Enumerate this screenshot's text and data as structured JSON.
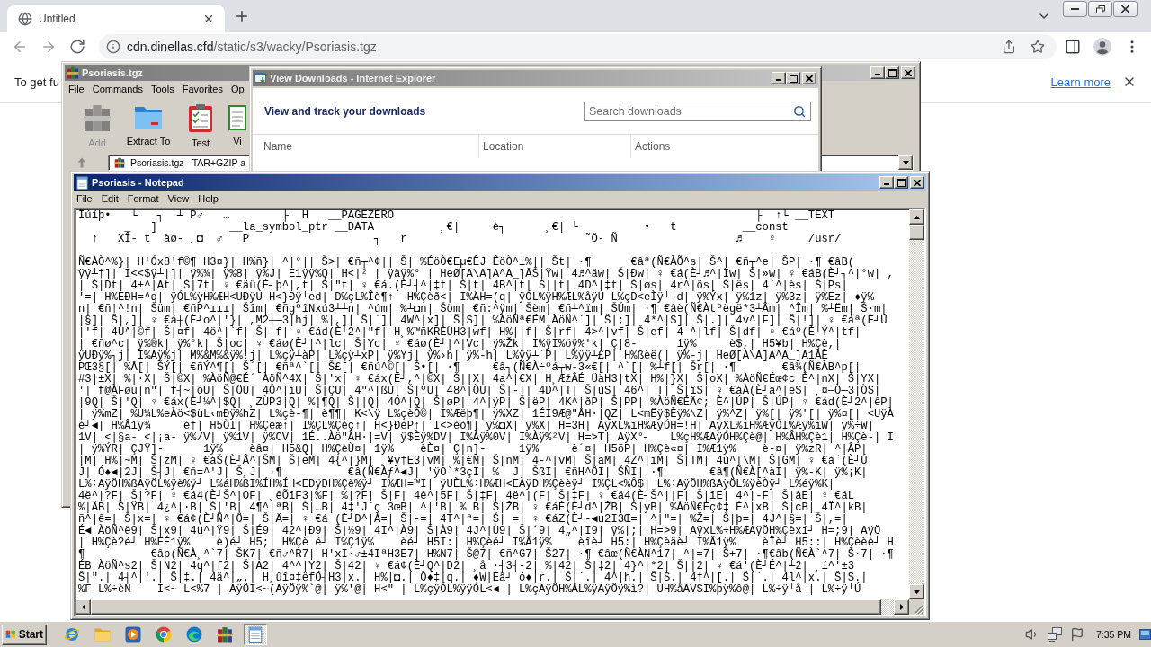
{
  "browser": {
    "tab": {
      "title": "Untitled"
    },
    "url": {
      "host": "cdn.dinellas.cfd",
      "path": "/static/s3/wacky/Psoriasis.tgz"
    },
    "infobar": {
      "text": "To get fu",
      "link": "Learn more"
    }
  },
  "winrar": {
    "title": "Psoriasis.tgz",
    "active": false,
    "menu": [
      "File",
      "Commands",
      "Tools",
      "Favorites",
      "Op"
    ],
    "toolbar": [
      {
        "kind": "add",
        "label": "Add",
        "disabled": true
      },
      {
        "kind": "extract",
        "label": "Extract To",
        "disabled": false
      },
      {
        "kind": "test",
        "label": "Test",
        "disabled": false
      },
      {
        "kind": "view",
        "label": "Vi",
        "disabled": false
      }
    ],
    "path": "Psoriasis.tgz - TAR+GZIP a"
  },
  "downloads": {
    "title": "View Downloads - Internet Explorer",
    "active": false,
    "heading": "View and track your downloads",
    "search": {
      "placeholder": "Search downloads"
    },
    "columns": [
      "Name",
      "Location",
      "Actions"
    ]
  },
  "notepad": {
    "title": "Psoriasis - Notepad",
    "active": true,
    "menu": [
      "File",
      "Edit",
      "Format",
      "View",
      "Help"
    ],
    "header_lines": [
      "Ïúíþ•   └   ┐  ┴ P♂   …        ├  H   __PAGEZERO                                                       ├  ↑└ __TEXT",
      "       _   ]           __la_symbol_ptr __DATA          ¸€|     è┐      ¸€| └          •   t          __const",
      "  ↑   XÎ- t  àø- ¸◘  ♂   P                   ┐   r                           ˜Ö- Ñ                  ♬    ♀     /usr/"
    ],
    "body_lines": [
      "Ñ€ÀÒ^%}| H'Óx8'f©¶ H3¤}| H%ñ}| ^|°|| Š>| €ñ┬^¢|| Š| %ÉöÒ€Eµ€ÊJ ÊöÒ^±%|| Št| ·¶      €âª(Ñ€ÀÕ^s| Š^| €ñ┬^e| ŠP| ·¶ €âB(",
      "ÿý┴†]| I<<$ÿ┴|]| ÿ%¾| ÿ%8| ÿ%J| E1ÿÿ%Q| H<|² | ÿàÿ%° | HeØ[A\\A]A^A_]ÅŠ|Ÿw| 4♬^äw| Š|Ðw| ♀ €á(È┘♬^|Ïw| Š|»w| ♀ €áB(È┘┐^|°w| ,",
      "| Š|Dt| 4±^|At| Š|7t| ♀ €äü(È┘þ^|,t| Š|\"t| ♀ €á.(È┘┤^|‡t| Š|t| 4B^|t| Š||t| 4D^|‡t| Š|øs| 4r^|ös| Š|ës| 4`^|ès| Š|Ps|",
      "'=| H%EÐH=^q| ÿÓL%ÿH%ÆH<UÐÿU H<}Ðÿ┴ed| D%çL%Îè¶↑  H%Çèð<| I%ÄH=(q| ÿÓL%ÿH%ÆL%åÿU L%çD<eÌÿ┴-d| ÿ%Ýx| ÿ%1z| ÿ%3z| ÿ%Ez| ♦ÿ%",
      "n| €ñ†^!n| Šüm| €ñP^ııı| Šîm| €ñgºîNxú3┴┴n| ^úm| %┴◘n| Šöm| €ñ:^ÿm| Šèm| €ñ┴^ïm| ŠÚm| ·¶ €âè(Ñ€Àtºëgë*3┴Âm| ^Îm| %┴Ëm| Š·m|",
      "|§]| Š|,]| ♀ €á┼(È┘o^|'}| ,M2┼─3|hj| %|,]| Š|`]| 4W^|x]| Š|S]| %ÀöÑª€ÉM ÀöÑ^`]| Š|;]| 4*^|S]| Š|.]| 4v^|F]| Š|!]| ♀ €áª(È┘Ú",
      "|'f| 4Ù^|©f| Š|¤f| 4ö^|`f| Š|—f| ♀ €ád(È┘2^|\"f| H¸%™ñKRÈÜH3|wf| H%||f| Š|rf| 4>^|vf| Š|ef| 4 ^|lf| Š|df| ♀ €áº(È┘Ý^|tf|",
      "| €ñø^c| ÿ%®k| ÿ%°k| Š|oc| ♀ €áø(È┘|^|lc| Š|Yc| ♀ €áø(È┘|^|Vc| ÿ%Žk| I%ÿI%öÿ%'k| Ç|8-      1ÿ%     è$,| H5¥b| H%Çè,|",
      "ÿUÐÿ%┐j| I%Äÿ%j| M%&M%&ÿ%!j| L%çÿ┴àP| L%çÿ┴xP| ÿ%Yj| ÿ%›h| ÿ%-h| L%ÿÿ┴´P| L%ÿÿ┴£P| H%ßèë(| ÿ%-j| HeØ[A\\A]A^A_]Å1ÀÈ",
      "PŒ3§[| %Å[| ŠÝ[| €ñÝ^¶[| Š´[| €ñª^`[| Š£[| €ñú^©[| Š•[| ·¶     €â┐(Ñ€À÷ºá┬w-3«€[| ^`[| %┴f[| Šr[| ·¶       €â¾(Ñ€ÀB^p[|",
      "#3|±X| %|·X| Š|©X| %ÀöÑ@€É´ ÀöÑ^4X| Š|'x| ♀ €áx(È┘,^|©X| Š||X| 4a^|€X| H¸ÆžÂÉ ÜäH3|tX| H%|}X| Š|oX| %ÀöÑ€Éœ¢c È^|nX| Š|YX|",
      "'| f@ÀFøü|ñ\"| f┤~|öU| Š|ÖU| 4Ô^|ïU| Š|ÇU| 4\"^|ßU| Š|ºU| 48^|ÒU| Š|-T| 4D^|T| Š|ùS| 46^| T| Š|îS| ♀ €áÀ(È┘à^|ëS| ¸¤─Ò─3|ÒS|",
      "|9Q| Š|'Q| ♀ €áx(È┘¼^|$Q| ¸ZÙP3|Q| %|¶Q| Š||Q| 4Ó^|Q| Š|øP| 4^|ÿP| Š|ëP| 4K^|ðP| Š|PP| %ÀöÑ€ÉÄ¢; È^|ÚP| Š|ÚP| ♀ €ád(È┘2^|êP|",
      "| ÿ%mZ| %U¼L%eÀö<$üL‹mÐÿ%hZ| L%çè-¶| è¶¶| K<\\ÿ L%çèÒ©| I%Æëþ¶| ÿ%XZ| 1ÉI9Æ@\"ÅH·|QZ| L<mËÿ$Èÿ%\\Z| ÿ%^Z| ÿ%[| ÿ%'[| ÿ%¤[| <UÿÀ",
      "è┘◄| H%Â1ÿ¾     è†| H5ÒI| H%Çèæ↑| I%ÇL%Çèç↑| H<}ÐèP↑| I<>èò¶| ÿ%◘X| ÿ%X| H=3H| AÿXL%ïH%ÆÿÓH=!H| AÿXL%ïH%ÆÿÓI%Æÿ%ïW| ÿ%÷W|",
      "1V| <|§a- <|¡a- ÿ%/V| ÿ%1V| ÿ%CV| 1É..Àö\"ÂH·|=V| ÿ$Èÿ%DV| I%Àÿ%0V| I%Àÿ%²V| H=>T| AÿX°┘   L%çH%ÆAÿÓH%Çè@| H%ÂH%Çè1| H%Çè-| I",
      "| ÿ%ÝR| ÇJŸ]-      1ÿ%    èâ¤| H5&Q| H%ÇèÙ¤| 1ÿ%    èÈ¤| Ç|n]-     1ÿ%     è´¤| H5õP| H%Çè«¤| I%Æ1ÿ%    è-¤| ÿ%zR| ^|ÂP|",
      "|M| H%|~M| Š|zM| ♀ €áŠ(È┘Â^|ŠM| Š|eM| 4{^|}M| ¸¥ý†E3|vM| %|€M| Š|nM| 4-^|vM| Š|aM| 4Z^|ïM| Š|TM| 4ù^|\\M| Š|GM| ♀ €á´(È┘Ú",
      "J| Ó♦◄|2J| Š┤J| €ñ=^'J| Š¸J| ·¶          €â(Ñ€Àƒ^◄J| 'ÿO`*3çI| %  J| ŠßI| €ñH^ÖI| ŠÑI| ·¶       €â¶(Ñ€À[^àI| ÿ%-K| ÿ%¡K|",
      "L%÷AÿÖH%ßAÿÖL%ÿè%ÿ┘ L%áH%ßI%ÍH%ÍH<EÐÿÐH%Çè%ÿ┘ I%ÆH=™I| ÿUÈL%÷H%ÆH<EÀÿÐH%Çèèÿ┘ I%ÇL<%Ô$| L%÷AÿÖH%ßAÿÖL%ÿèÒÿ┘ L%éÿ%K|",
      "4ë^|?F| Š|?F| ♀ €á4(È┘Š^|OF| ¸êÕîF3|%F| %|?F| Š|F| 4ê^|5F| Š|‡F| 4ë^|(F| Š|‡F| ♀ €á4(È┘Š^||F| Š|îE| 4^|-F| Š|âE| ♀ €áL",
      "%|ÂB| Š|ŸB| 4¿^|·B| Š|'B| 4¶^|ªB| Š|…B| 4‡'J`ç 3œB| ^|'B| % B| Š|ŽB| ♀ €áÉ(È┘d^|ŽB| Š|yB| %ÀöÑ€Éç¢‡ È^|xB| Š|cB| 4Ï^|kB|",
      "ñ^|ê=| Š|x=| ♀ €á¢(È┘Ñ^|Ö=| Š|Ä=| ♀ €á (È┘Ð^|À=| Š|-=| 4T^|ª=| Š| =| ♀ €áZ(È┘-◄u2I3Œ=| ^|\"=| %Ž=| Š|þ=| 4J^|§=| Š|,=|",
      "É◄ ÀöÑ^ë9| Š|x9| 4u^|Ÿ9| Š|É9| 42^|Ð9| Š|½9| 4I^|À9| Š|À9| 4J^|Ù9| Š|´9| 4„^|I9| ÿ%|;| H=>9| AÿxL%÷H%ÆAÿÖH%Çèxí┘ H=;9| AÿÖ",
      "| H%Çè?é┘ H%ÉÈ1ÿ%    è)é┘ H5;| H%Çè é┘ I%Ç1ÿ%    èé┘ H5I:| H%Çèé┘ I%Â1ÿ%    èîè┘ H5:| H%Çèäè┘ I%Â1ÿ%    èÏè┘ H5::| H%Çèèè┘ H",
      "¶          €âp(Ñ€À¸^`7| ŠK7| €ñ♂^R7| H'xI·♂±4IªH3E7| H%N7| Š@7| €ñ^G7| Š27| ·¶ €âœ(Ñ€ÀN^17| ^|=7| Š+7| ·¶€âb(Ñ€À`^7| Š·7| ·¶",
      "ÉB ÀöÑ^s2| Š|N2| 4q^|f2| Š|A2| 4^^|Y2| Š|42| ♀ €á¢(È┘Q^|D2| ¸å ·┤3┤-2| %|42| Š|‡2| 4}^|*2| Š||2| ♀ €á'(È┘É^|┴2| ¸í^'±3",
      "Š|\".| 4┤^|'.| Š|‡.| 4ä^|„.| H¸ûî¤‡ëfÓ┤H3|x.| H%|◘.| Ò♦‡|q.| ♦W|Èâ┘ ó♦|r.| Š|`.| 4^|h.| Š|S.| 4†^|[.| Š|`.| 4l^|x.| Š|S.|",
      "%F L%÷èN    I<~ L<%7 | AÿÖI<~(AÿÖÿ%`@| ÿ%'@| H<\" | L%çÿÓL%ÿÿÓL<◄ | L%çAÿÖH%ÅL%ÿAÿÖÿ%ì?| UH%åAVSI%þÿ%ô@| L%÷ÿ┴å | L%÷ÿ┴Ú"
    ]
  },
  "taskbar": {
    "start": "Start",
    "apps": [
      {
        "kind": "ie",
        "selected": false
      },
      {
        "kind": "folder",
        "selected": false
      },
      {
        "kind": "media",
        "selected": false
      },
      {
        "kind": "chrome",
        "selected": false
      },
      {
        "kind": "edge",
        "selected": false
      },
      {
        "kind": "winrar",
        "selected": false
      },
      {
        "kind": "notepad",
        "selected": true
      }
    ],
    "clock": "7:35 PM"
  }
}
